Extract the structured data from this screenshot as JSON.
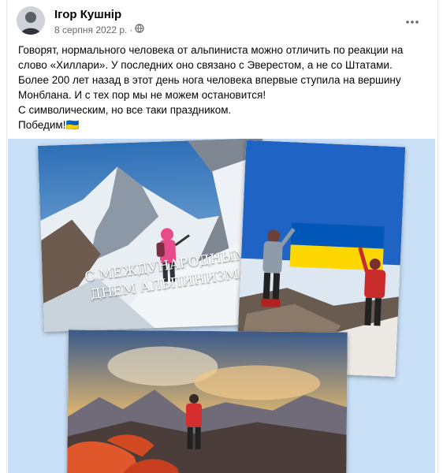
{
  "post": {
    "author": "Ігор Кушнір",
    "date": "8 серпня 2022 р.",
    "separator": "·",
    "privacy_icon": "globe-icon",
    "more_icon": "more-horizontal-icon",
    "body_lines": [
      "Говорят, нормального человека от альпиниста можно отличить по реакции на",
      "слово «Хиллари». У последних оно связано с Эверестом, а не со Штатами.",
      "Более 200 лет назад в этот день нога человека впервые ступила на вершину",
      "Монблана. И с тех пор мы не можем остановится!",
      "С символическим, но все таки праздником.",
      "Победим!"
    ],
    "flag_emoji": "🇺🇦"
  },
  "image": {
    "caption_line1": "С МЕЖДУНАРОДНЫМ",
    "caption_line2": "ДНЕМ АЛЬПИНИЗМА!"
  },
  "colors": {
    "photo_background": "#c9dff6",
    "flag_blue": "#0057b7",
    "flag_yellow": "#ffd700",
    "meta_gray": "#65676b"
  }
}
